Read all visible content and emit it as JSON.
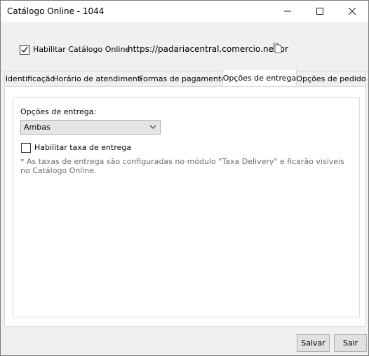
{
  "window": {
    "title": "Catálogo Online - 1044"
  },
  "top": {
    "enable_label": "Habilitar Catálogo Online",
    "enable_checked": true,
    "url": "https://padariacentral.comercio.net.br"
  },
  "tabs": [
    {
      "label": "Identificação"
    },
    {
      "label": "Horário de atendimento"
    },
    {
      "label": "Formas de pagamento"
    },
    {
      "label": "Opções de entrega",
      "active": true
    },
    {
      "label": "Opções de pedido"
    }
  ],
  "delivery": {
    "options_label": "Opções de entrega:",
    "selected": "Ambas",
    "fee_label": "Habilitar taxa de entrega",
    "fee_checked": false,
    "note": "* As taxas de entrega são configuradas no módulo \"Taxa Delivery\" e ficarão visíveis no Catálogo Online."
  },
  "buttons": {
    "save": "Salvar",
    "exit": "Sair"
  },
  "icons": {
    "minimize": "minimize-icon",
    "maximize": "maximize-icon",
    "close": "close-icon",
    "copy": "copy-icon",
    "chevron": "chevron-down-icon"
  }
}
